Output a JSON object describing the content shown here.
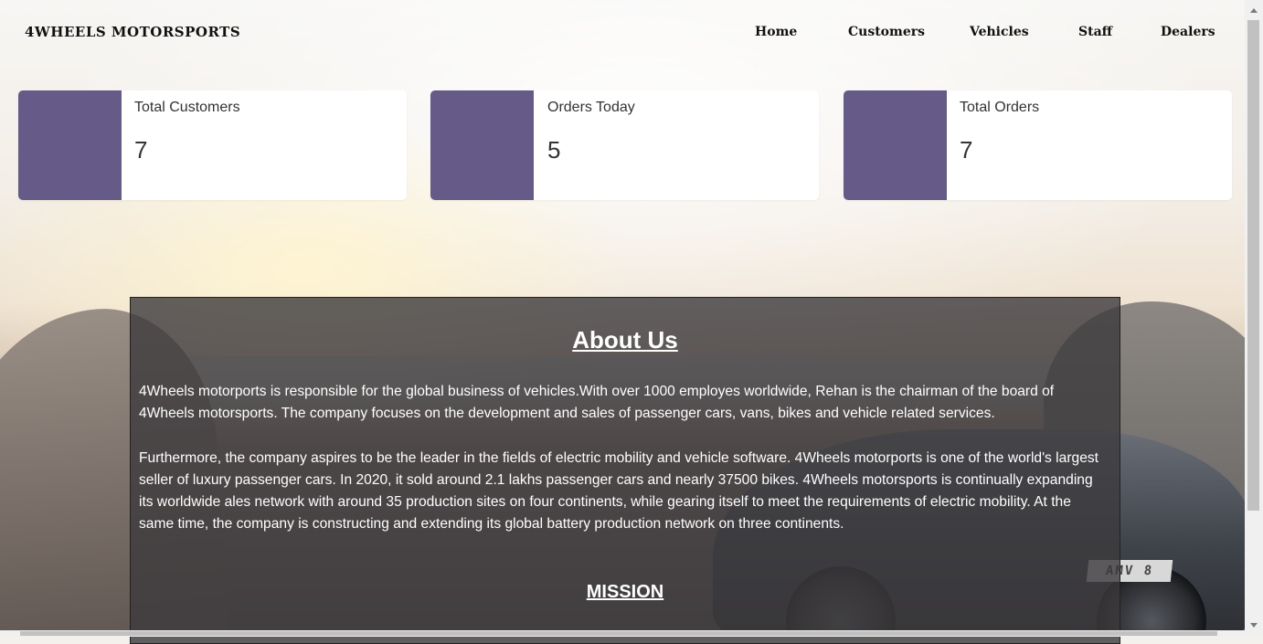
{
  "brand": "4WHEELS MOTORSPORTS",
  "nav": [
    {
      "label": "Home"
    },
    {
      "label": "Customers"
    },
    {
      "label": "Vehicles"
    },
    {
      "label": "Staff"
    },
    {
      "label": "Dealers"
    }
  ],
  "stats": [
    {
      "label": "Total Customers",
      "value": "7"
    },
    {
      "label": "Orders Today",
      "value": "5"
    },
    {
      "label": "Total Orders",
      "value": "7"
    }
  ],
  "about": {
    "title": "About Us",
    "paragraphs": [
      "4Wheels motorports is responsible for the global business of vehicles.With over 1000 employes worldwide, Rehan is the chairman of the board of 4Wheels motorsports. The company focuses on the development and sales of passenger cars, vans, bikes and vehicle related services.",
      "Furthermore, the company aspires to be the leader in the fields of electric mobility and vehicle software. 4Wheels motorports is one of the world's largest seller of luxury passenger cars. In 2020, it sold around 2.1 lakhs passenger cars and nearly 37500 bikes. 4Wheels motorsports is continually expanding its worldwide ales network with around 35 production sites on four continents, while gearing itself to meet the requirements of electric mobility. At the same time, the company is constructing and extending its global battery production network on three continents."
    ],
    "mission_heading": "MISSION"
  },
  "background": {
    "plate_text": "AMV 8"
  },
  "colors": {
    "card_accent": "#655a88",
    "panel": "#3c3a3c"
  }
}
